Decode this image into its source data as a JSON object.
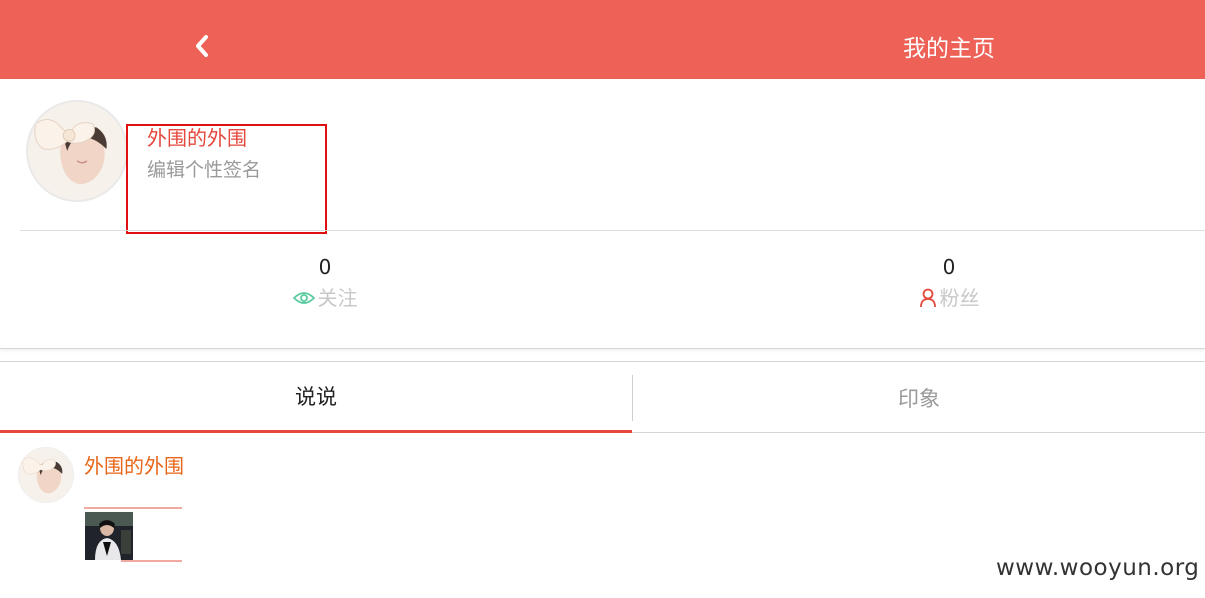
{
  "header": {
    "title": "我的主页",
    "back_icon": "chevron-left-icon",
    "background": "#ee6157"
  },
  "profile": {
    "username": "外围的外围",
    "signature_placeholder": "编辑个性签名",
    "stats": [
      {
        "value": "0",
        "label": "关注",
        "icon": "eye-icon",
        "icon_color": "#5ccca0"
      },
      {
        "value": "0",
        "label": "粉丝",
        "icon": "user-icon",
        "icon_color": "#e5483c"
      }
    ]
  },
  "tabs": [
    {
      "label": "说说",
      "active": true
    },
    {
      "label": "印象",
      "active": false
    }
  ],
  "post": {
    "author": "外围的外围"
  },
  "watermark": "www.wooyun.org",
  "colors": {
    "accent": "#e5483c",
    "author_orange": "#e8661a",
    "highlight_box": "#e01010"
  }
}
